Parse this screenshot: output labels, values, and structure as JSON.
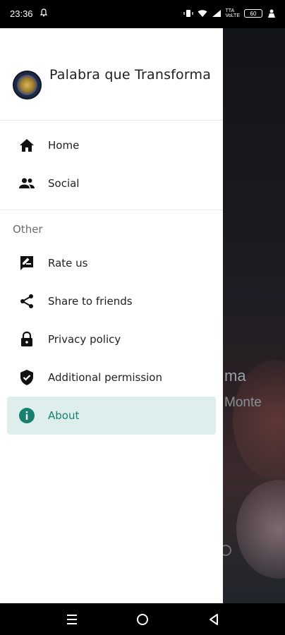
{
  "status_bar": {
    "time": "23:36",
    "battery": "60",
    "network_top": "TTA",
    "network_bottom": "VoLTE"
  },
  "background_app": {
    "text1": "ma",
    "text2": "Monte"
  },
  "drawer": {
    "title": "Palabra que Transforma",
    "main_items": [
      {
        "label": "Home",
        "icon": "home-icon"
      },
      {
        "label": "Social",
        "icon": "people-icon"
      }
    ],
    "section_label": "Other",
    "other_items": [
      {
        "label": "Rate us",
        "icon": "rate-icon"
      },
      {
        "label": "Share to friends",
        "icon": "share-icon"
      },
      {
        "label": "Privacy policy",
        "icon": "lock-icon"
      },
      {
        "label": "Additional permission",
        "icon": "shield-check-icon"
      },
      {
        "label": "About",
        "icon": "info-icon",
        "active": true
      }
    ]
  },
  "colors": {
    "accent": "#17806f",
    "active_bg": "#ddeeed",
    "drawer_bg": "#ffffff"
  }
}
